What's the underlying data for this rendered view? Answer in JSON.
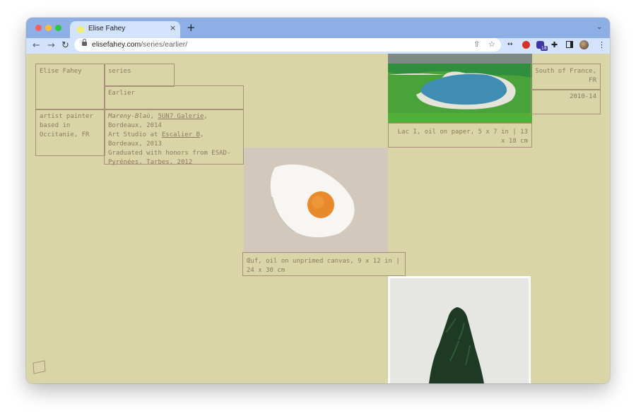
{
  "browser": {
    "tab_title": "Elise Fahey",
    "tab_close": "×",
    "new_tab": "+",
    "tab_menu": "⌄",
    "url_host": "elisefahey.com",
    "url_path": "/series/earlier/",
    "back_icon": "←",
    "forward_icon": "→",
    "reload_icon": "↻",
    "share_icon": "⇧",
    "bookmark_icon": "☆",
    "ext_badge": "18",
    "menu_icon": "⋮"
  },
  "site": {
    "name": "Elise Fahey",
    "bio": "artist painter based in Occitanie, FR",
    "nav_label": "series",
    "series_title": "Earlier",
    "history": {
      "line1_italic": "Mareny-Blaù",
      "line1_sep": ", ",
      "line1_link": "5UN7 Galerie",
      "line1_rest": ", Bordeaux, 2014",
      "line2_pre": "Art Studio at ",
      "line2_link": "Escalier B",
      "line2_rest": ", Bordeaux, 2013",
      "line3": "Graduated with honors from ESAD-Pyrénées, Tarbes, 2012"
    },
    "location": "South of France, FR",
    "years": "2010-14"
  },
  "works": [
    {
      "caption": "Lac I, oil on paper, 5 x 7 in | 13 x 18 cm"
    },
    {
      "caption": "Œuf, oil on unprimed canvas, 9 x 12 in | 24 x 30 cm"
    },
    {
      "caption": ""
    }
  ],
  "colors": {
    "page_bg": "#d9d5a7",
    "border": "#a89078",
    "text": "#8c7a62",
    "tabstrip": "#8eaee6",
    "toolbar": "#d3e3fd"
  }
}
